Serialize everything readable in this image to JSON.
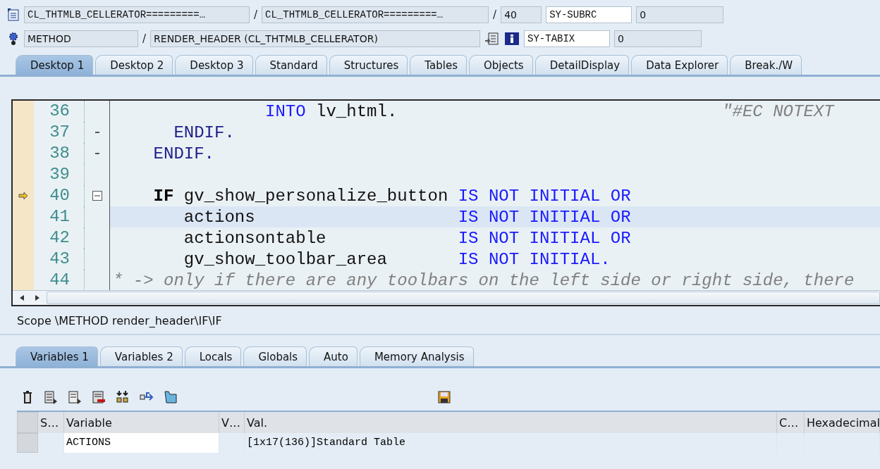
{
  "header": {
    "program": "CL_THTMLB_CELLERATOR=========…",
    "include": "CL_THTMLB_CELLERATOR=========…",
    "line": "40",
    "event_type": "METHOD",
    "event": "RENDER_HEADER (CL_THTMLB_CELLERATOR)",
    "sys_fields": [
      {
        "name": "SY-SUBRC",
        "value": "0"
      },
      {
        "name": "SY-TABIX",
        "value": "0"
      }
    ],
    "separator": "/"
  },
  "desktop_tabs": [
    {
      "label": "Desktop 1",
      "selected": true
    },
    {
      "label": "Desktop 2",
      "selected": false
    },
    {
      "label": "Desktop 3",
      "selected": false
    },
    {
      "label": "Standard",
      "selected": false
    },
    {
      "label": "Structures",
      "selected": false
    },
    {
      "label": "Tables",
      "selected": false
    },
    {
      "label": "Objects",
      "selected": false
    },
    {
      "label": "DetailDisplay",
      "selected": false
    },
    {
      "label": "Data Explorer",
      "selected": false
    },
    {
      "label": "Break./W",
      "selected": false
    }
  ],
  "code_lines": [
    {
      "number": "36",
      "current": false,
      "cursor": false,
      "collapsible": false,
      "block_end": false,
      "segments": [
        {
          "kind": "keyword",
          "text": "               INTO"
        },
        {
          "kind": "plain",
          "text": " lv_html.                                "
        },
        {
          "kind": "comment",
          "text": "\"#EC NOTEXT"
        }
      ]
    },
    {
      "number": "37",
      "current": false,
      "cursor": false,
      "collapsible": false,
      "block_end": true,
      "segments": [
        {
          "kind": "block",
          "text": "      ENDIF."
        }
      ]
    },
    {
      "number": "38",
      "current": false,
      "cursor": false,
      "collapsible": false,
      "block_end": true,
      "segments": [
        {
          "kind": "block",
          "text": "    ENDIF."
        }
      ]
    },
    {
      "number": "39",
      "current": false,
      "cursor": false,
      "collapsible": false,
      "block_end": false
    },
    {
      "number": "40",
      "current": true,
      "cursor": false,
      "collapsible": true,
      "block_end": false,
      "segments": [
        {
          "kind": "keyword-bold",
          "text": "    IF"
        },
        {
          "kind": "plain",
          "text": " gv_show_personalize_button "
        },
        {
          "kind": "keyword",
          "text": "IS NOT INITIAL OR"
        }
      ]
    },
    {
      "number": "41",
      "current": false,
      "cursor": true,
      "collapsible": false,
      "block_end": false,
      "segments": [
        {
          "kind": "plain",
          "text": "       actions                    "
        },
        {
          "kind": "keyword",
          "text": "IS NOT INITIAL OR"
        }
      ]
    },
    {
      "number": "42",
      "current": false,
      "cursor": false,
      "collapsible": false,
      "block_end": false,
      "segments": [
        {
          "kind": "plain",
          "text": "       actionsontable             "
        },
        {
          "kind": "keyword",
          "text": "IS NOT INITIAL OR"
        }
      ]
    },
    {
      "number": "43",
      "current": false,
      "cursor": false,
      "collapsible": false,
      "block_end": false,
      "segments": [
        {
          "kind": "plain",
          "text": "       gv_show_toolbar_area       "
        },
        {
          "kind": "keyword",
          "text": "IS NOT INITIAL."
        }
      ]
    },
    {
      "number": "44",
      "current": false,
      "cursor": false,
      "collapsible": false,
      "block_end": false,
      "segments": [
        {
          "kind": "comment",
          "text": "* -> only if there are any toolbars on the left side or right side, there"
        }
      ]
    }
  ],
  "scope": "Scope \\METHOD render_header\\IF\\IF",
  "variable_tabs": [
    {
      "label": "Variables 1",
      "selected": true
    },
    {
      "label": "Variables 2",
      "selected": false
    },
    {
      "label": "Locals",
      "selected": false
    },
    {
      "label": "Globals",
      "selected": false
    },
    {
      "label": "Auto",
      "selected": false
    },
    {
      "label": "Memory Analysis",
      "selected": false
    }
  ],
  "table": {
    "columns": [
      "S…",
      "Variable",
      "V…",
      "Val.",
      "C…",
      "Hexadecimal"
    ],
    "rows": [
      [
        "",
        "ACTIONS",
        "",
        "[1x17(136)]Standard Table",
        "",
        ""
      ]
    ]
  }
}
